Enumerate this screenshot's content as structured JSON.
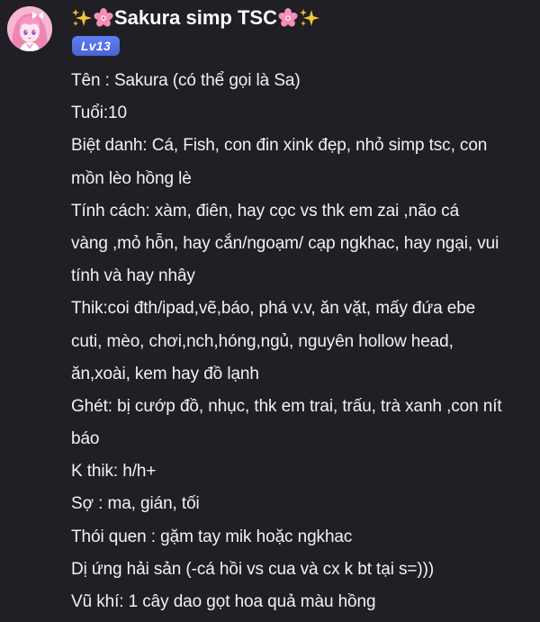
{
  "post": {
    "author": {
      "name": "Sakura simp TSC",
      "level_badge": "Lv13",
      "avatar_icon": "anime-girl-avatar",
      "decorations": [
        "sparkles-icon",
        "cherry-blossom-icon"
      ]
    },
    "bio_lines": [
      "Tên : Sakura (có thể gọi là Sa)",
      "Tuổi:10",
      "Biệt danh: Cá, Fish, con đin xink đẹp, nhỏ simp tsc, con",
      "mồn lèo hồng lè",
      "Tính cách: xàm, điên, hay cọc vs thk em zai ,não cá",
      "vàng ,mỏ hỗn, hay cắn/ngoạm/ cạp ngkhac, hay ngại, vui",
      "tính và hay nhây",
      "Thik:coi đth/ipad,vẽ,báo, phá v.v, ăn vặt, mấy đứa ebe",
      "cuti, mèo, chơi,nch,hóng,ngủ, nguyên hollow head,",
      "ăn,xoài, kem hay đồ lạnh",
      "Ghét: bị cướp đồ, nhục, thk em trai, trấu, trà xanh ,con nít",
      "báo",
      "K thik: h/h+",
      "Sợ : ma, gián, tối",
      "Thói quen : gặm tay mik hoặc ngkhac",
      "Dị ứng hải sản (-cá hồi vs cua và cx k bt tại s=)))",
      "Vũ khí: 1 cây dao gọt hoa quả màu hồng"
    ]
  },
  "colors": {
    "background": "#1f1f25",
    "text": "#f2f2f4",
    "badge": "#5570e6",
    "sparkle": "#f7c531",
    "blossom": "#f48fb8"
  }
}
